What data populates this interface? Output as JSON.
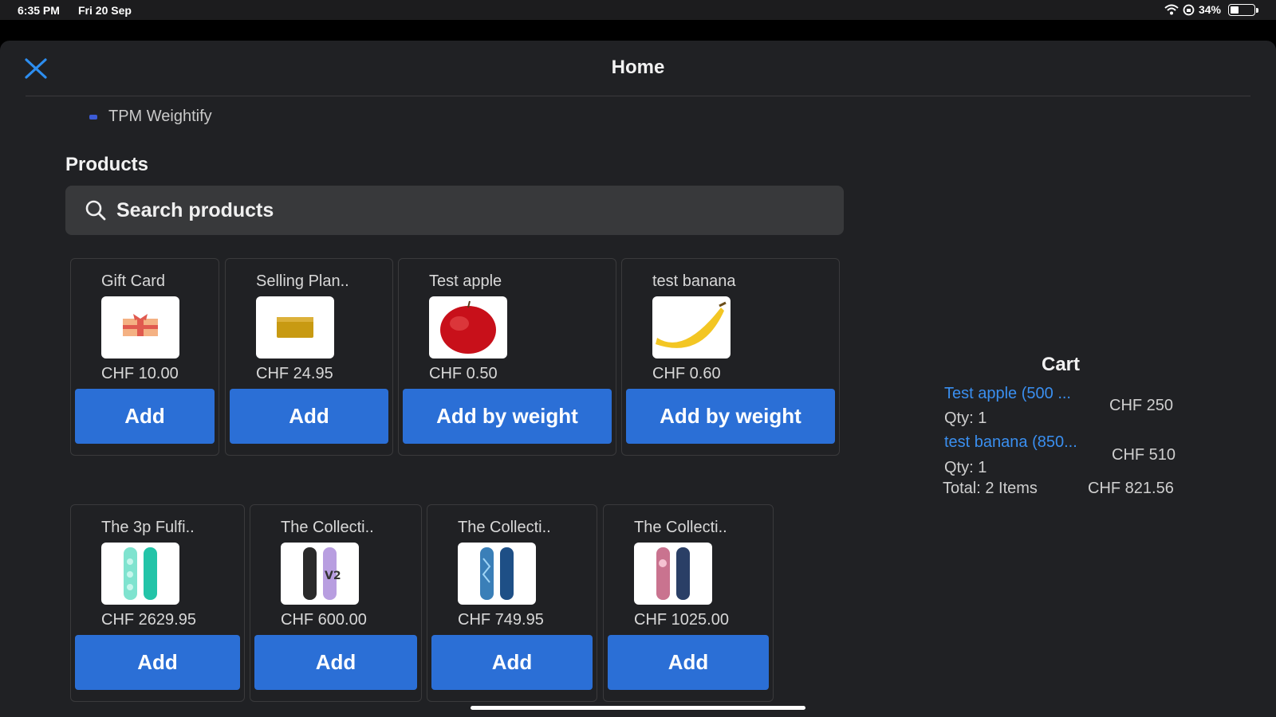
{
  "status_bar": {
    "time": "6:35 PM",
    "date": "Fri 20 Sep",
    "battery_text": "34%",
    "battery_level": 0.34
  },
  "nav": {
    "title": "Home"
  },
  "app": {
    "name": "TPM Weightify"
  },
  "products": {
    "title": "Products",
    "search_placeholder": "Search products",
    "items": [
      {
        "title": "Gift Card",
        "price": "CHF 10.00",
        "button": "Add",
        "image": "gift-card-image"
      },
      {
        "title": "Selling Plan..",
        "price": "CHF 24.95",
        "button": "Add",
        "image": "soap-bar-image"
      },
      {
        "title": "Test apple",
        "price": "CHF 0.50",
        "button": "Add by weight",
        "image": "apple-image"
      },
      {
        "title": "test banana",
        "price": "CHF 0.60",
        "button": "Add by weight",
        "image": "banana-image"
      },
      {
        "title": "The 3p Fulfi..",
        "price": "CHF 2629.95",
        "button": "Add",
        "image": "snowboard-teal-image"
      },
      {
        "title": "The Collecti..",
        "price": "CHF 600.00",
        "button": "Add",
        "image": "snowboard-purple-image"
      },
      {
        "title": "The Collecti..",
        "price": "CHF 749.95",
        "button": "Add",
        "image": "snowboard-blue-image"
      },
      {
        "title": "The Collecti..",
        "price": "CHF 1025.00",
        "button": "Add",
        "image": "snowboard-pink-image"
      }
    ]
  },
  "cart": {
    "title": "Cart",
    "items": [
      {
        "name": "Test apple (500 ...",
        "qty": "Qty: 1",
        "price": "CHF 250"
      },
      {
        "name": "test banana (850...",
        "qty": "Qty: 1",
        "price": "CHF 510"
      }
    ],
    "total_label": "Total: 2 Items",
    "total_price": "CHF 821.56"
  },
  "colors": {
    "accent": "#2b6fd6",
    "link": "#3a8ff0",
    "background": "#202124"
  }
}
